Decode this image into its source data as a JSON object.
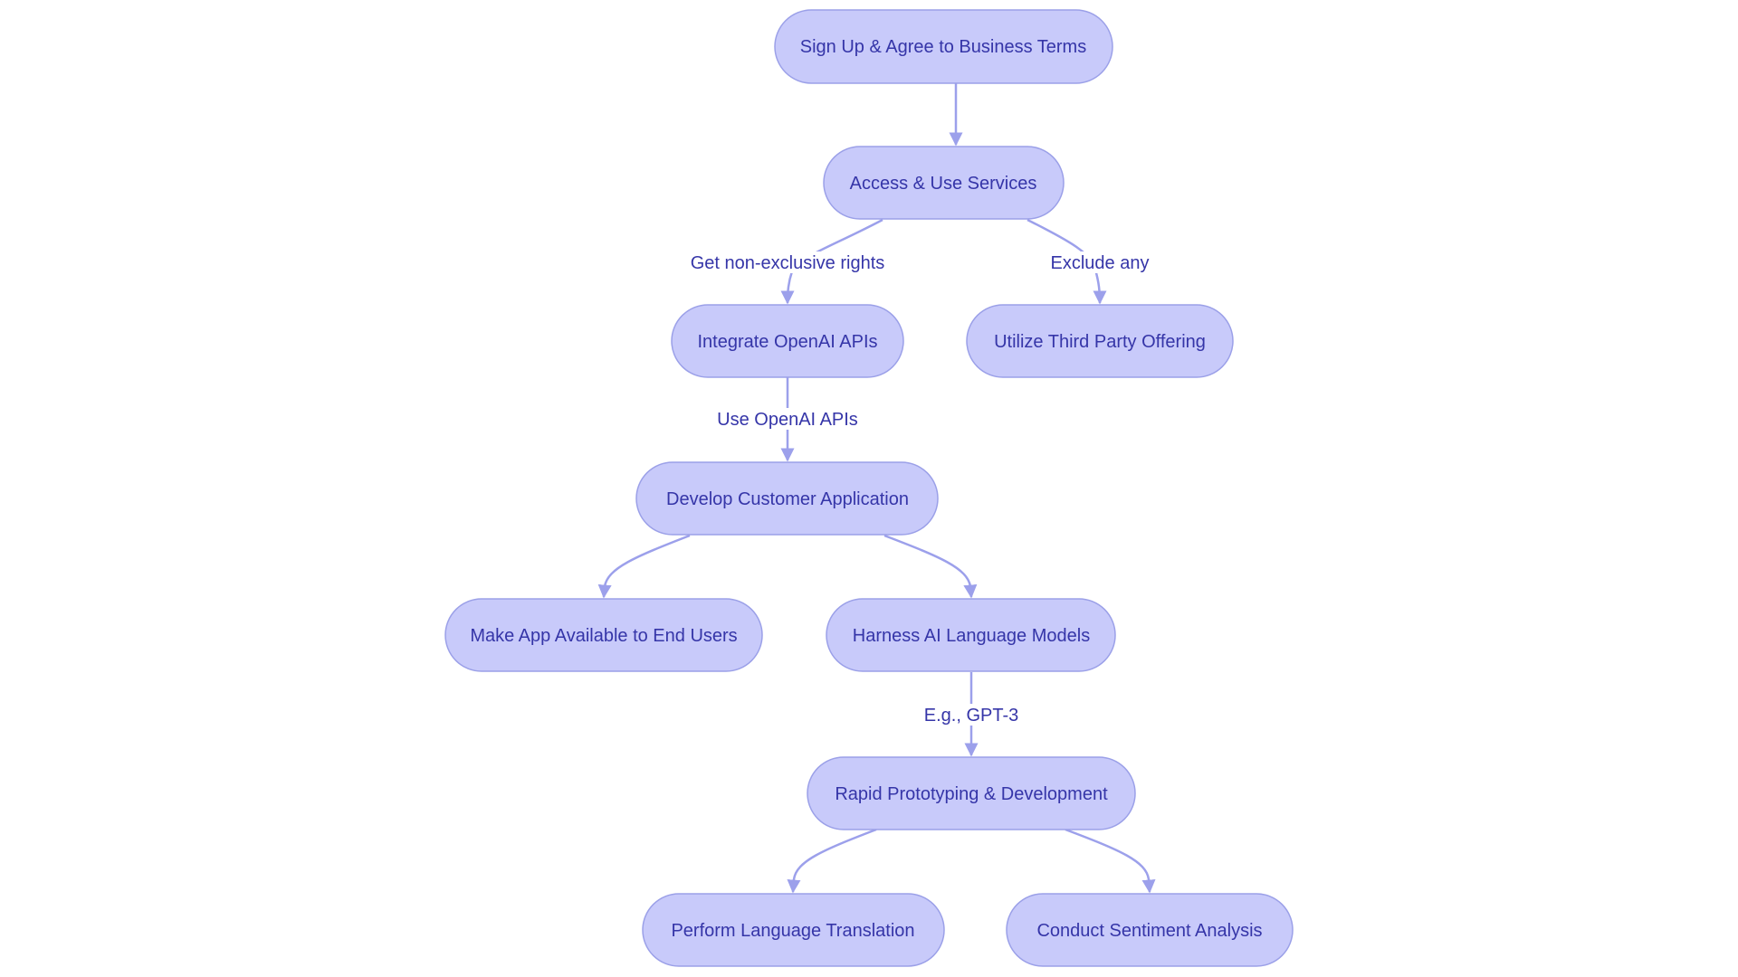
{
  "diagram": {
    "type": "flowchart",
    "direction": "top-down",
    "colors": {
      "node_fill": "#c8cafa",
      "node_stroke": "#9ba0e8",
      "text": "#3535a8",
      "edge": "#9ca0eb"
    },
    "nodes": [
      {
        "id": "signup",
        "label": "Sign Up & Agree to Business Terms"
      },
      {
        "id": "access",
        "label": "Access & Use Services"
      },
      {
        "id": "integrate",
        "label": "Integrate OpenAI APIs"
      },
      {
        "id": "thirdparty",
        "label": "Utilize Third Party Offering"
      },
      {
        "id": "develop",
        "label": "Develop Customer Application"
      },
      {
        "id": "makeapp",
        "label": "Make App Available to End Users"
      },
      {
        "id": "harness",
        "label": "Harness AI Language Models"
      },
      {
        "id": "rapid",
        "label": "Rapid Prototyping & Development"
      },
      {
        "id": "translate",
        "label": "Perform Language Translation"
      },
      {
        "id": "sentiment",
        "label": "Conduct Sentiment Analysis"
      }
    ],
    "edges": [
      {
        "from": "signup",
        "to": "access",
        "label": ""
      },
      {
        "from": "access",
        "to": "integrate",
        "label": "Get non-exclusive rights"
      },
      {
        "from": "access",
        "to": "thirdparty",
        "label": "Exclude any"
      },
      {
        "from": "integrate",
        "to": "develop",
        "label": "Use OpenAI APIs"
      },
      {
        "from": "develop",
        "to": "makeapp",
        "label": ""
      },
      {
        "from": "develop",
        "to": "harness",
        "label": ""
      },
      {
        "from": "harness",
        "to": "rapid",
        "label": "E.g., GPT-3"
      },
      {
        "from": "rapid",
        "to": "translate",
        "label": ""
      },
      {
        "from": "rapid",
        "to": "sentiment",
        "label": ""
      }
    ]
  }
}
